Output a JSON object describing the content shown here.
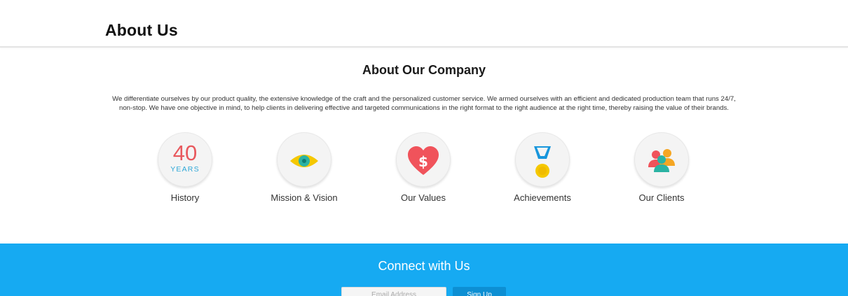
{
  "header": {
    "title": "About Us"
  },
  "about": {
    "heading": "About Our Company",
    "description": "We differentiate ourselves by our product quality, the extensive knowledge of the craft and the personalized customer service. We armed ourselves with an efficient and dedicated production team that runs 24/7, non-stop. We have one objective in mind, to help clients in delivering effective and targeted communications in the right format to the right audience at the right time, thereby raising the value of their brands."
  },
  "features": [
    {
      "label": "History",
      "icon": "years-badge-icon",
      "number": "40",
      "unit": "YEARS"
    },
    {
      "label": "Mission & Vision",
      "icon": "eye-icon"
    },
    {
      "label": "Our Values",
      "icon": "heart-dollar-icon"
    },
    {
      "label": "Achievements",
      "icon": "medal-icon"
    },
    {
      "label": "Our Clients",
      "icon": "users-icon"
    }
  ],
  "connect": {
    "heading": "Connect with Us",
    "email_placeholder": "Email Address",
    "signup_label": "Sign Up"
  },
  "colors": {
    "accent_blue": "#16aaf2",
    "button_blue": "#0d8fd3",
    "history_red": "#e8595e",
    "heart_red": "#f0535b",
    "eye_yellow": "#f5c800",
    "teal": "#2bb3a3",
    "client_orange": "#f5a623"
  }
}
